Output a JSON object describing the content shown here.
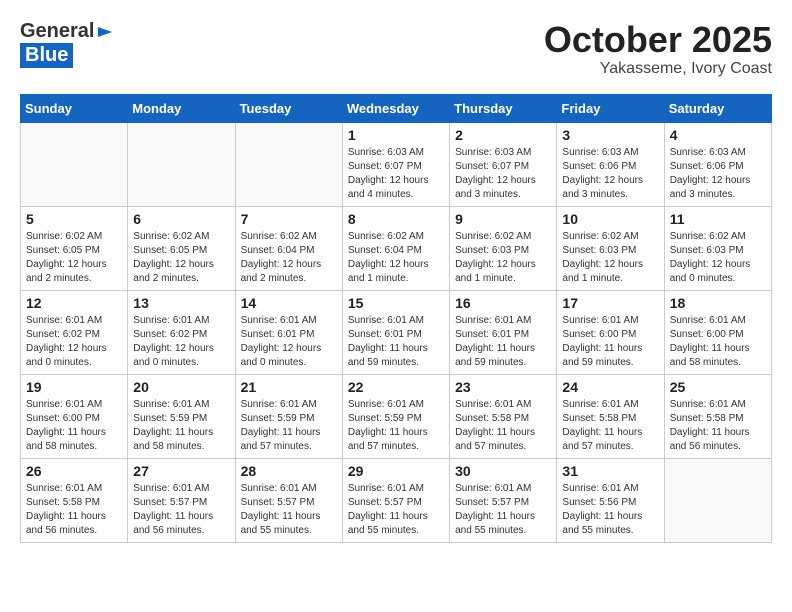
{
  "header": {
    "logo_general": "General",
    "logo_blue": "Blue",
    "title": "October 2025",
    "subtitle": "Yakasseme, Ivory Coast"
  },
  "weekdays": [
    "Sunday",
    "Monday",
    "Tuesday",
    "Wednesday",
    "Thursday",
    "Friday",
    "Saturday"
  ],
  "weeks": [
    [
      {
        "day": "",
        "info": ""
      },
      {
        "day": "",
        "info": ""
      },
      {
        "day": "",
        "info": ""
      },
      {
        "day": "1",
        "info": "Sunrise: 6:03 AM\nSunset: 6:07 PM\nDaylight: 12 hours\nand 4 minutes."
      },
      {
        "day": "2",
        "info": "Sunrise: 6:03 AM\nSunset: 6:07 PM\nDaylight: 12 hours\nand 3 minutes."
      },
      {
        "day": "3",
        "info": "Sunrise: 6:03 AM\nSunset: 6:06 PM\nDaylight: 12 hours\nand 3 minutes."
      },
      {
        "day": "4",
        "info": "Sunrise: 6:03 AM\nSunset: 6:06 PM\nDaylight: 12 hours\nand 3 minutes."
      }
    ],
    [
      {
        "day": "5",
        "info": "Sunrise: 6:02 AM\nSunset: 6:05 PM\nDaylight: 12 hours\nand 2 minutes."
      },
      {
        "day": "6",
        "info": "Sunrise: 6:02 AM\nSunset: 6:05 PM\nDaylight: 12 hours\nand 2 minutes."
      },
      {
        "day": "7",
        "info": "Sunrise: 6:02 AM\nSunset: 6:04 PM\nDaylight: 12 hours\nand 2 minutes."
      },
      {
        "day": "8",
        "info": "Sunrise: 6:02 AM\nSunset: 6:04 PM\nDaylight: 12 hours\nand 1 minute."
      },
      {
        "day": "9",
        "info": "Sunrise: 6:02 AM\nSunset: 6:03 PM\nDaylight: 12 hours\nand 1 minute."
      },
      {
        "day": "10",
        "info": "Sunrise: 6:02 AM\nSunset: 6:03 PM\nDaylight: 12 hours\nand 1 minute."
      },
      {
        "day": "11",
        "info": "Sunrise: 6:02 AM\nSunset: 6:03 PM\nDaylight: 12 hours\nand 0 minutes."
      }
    ],
    [
      {
        "day": "12",
        "info": "Sunrise: 6:01 AM\nSunset: 6:02 PM\nDaylight: 12 hours\nand 0 minutes."
      },
      {
        "day": "13",
        "info": "Sunrise: 6:01 AM\nSunset: 6:02 PM\nDaylight: 12 hours\nand 0 minutes."
      },
      {
        "day": "14",
        "info": "Sunrise: 6:01 AM\nSunset: 6:01 PM\nDaylight: 12 hours\nand 0 minutes."
      },
      {
        "day": "15",
        "info": "Sunrise: 6:01 AM\nSunset: 6:01 PM\nDaylight: 11 hours\nand 59 minutes."
      },
      {
        "day": "16",
        "info": "Sunrise: 6:01 AM\nSunset: 6:01 PM\nDaylight: 11 hours\nand 59 minutes."
      },
      {
        "day": "17",
        "info": "Sunrise: 6:01 AM\nSunset: 6:00 PM\nDaylight: 11 hours\nand 59 minutes."
      },
      {
        "day": "18",
        "info": "Sunrise: 6:01 AM\nSunset: 6:00 PM\nDaylight: 11 hours\nand 58 minutes."
      }
    ],
    [
      {
        "day": "19",
        "info": "Sunrise: 6:01 AM\nSunset: 6:00 PM\nDaylight: 11 hours\nand 58 minutes."
      },
      {
        "day": "20",
        "info": "Sunrise: 6:01 AM\nSunset: 5:59 PM\nDaylight: 11 hours\nand 58 minutes."
      },
      {
        "day": "21",
        "info": "Sunrise: 6:01 AM\nSunset: 5:59 PM\nDaylight: 11 hours\nand 57 minutes."
      },
      {
        "day": "22",
        "info": "Sunrise: 6:01 AM\nSunset: 5:59 PM\nDaylight: 11 hours\nand 57 minutes."
      },
      {
        "day": "23",
        "info": "Sunrise: 6:01 AM\nSunset: 5:58 PM\nDaylight: 11 hours\nand 57 minutes."
      },
      {
        "day": "24",
        "info": "Sunrise: 6:01 AM\nSunset: 5:58 PM\nDaylight: 11 hours\nand 57 minutes."
      },
      {
        "day": "25",
        "info": "Sunrise: 6:01 AM\nSunset: 5:58 PM\nDaylight: 11 hours\nand 56 minutes."
      }
    ],
    [
      {
        "day": "26",
        "info": "Sunrise: 6:01 AM\nSunset: 5:58 PM\nDaylight: 11 hours\nand 56 minutes."
      },
      {
        "day": "27",
        "info": "Sunrise: 6:01 AM\nSunset: 5:57 PM\nDaylight: 11 hours\nand 56 minutes."
      },
      {
        "day": "28",
        "info": "Sunrise: 6:01 AM\nSunset: 5:57 PM\nDaylight: 11 hours\nand 55 minutes."
      },
      {
        "day": "29",
        "info": "Sunrise: 6:01 AM\nSunset: 5:57 PM\nDaylight: 11 hours\nand 55 minutes."
      },
      {
        "day": "30",
        "info": "Sunrise: 6:01 AM\nSunset: 5:57 PM\nDaylight: 11 hours\nand 55 minutes."
      },
      {
        "day": "31",
        "info": "Sunrise: 6:01 AM\nSunset: 5:56 PM\nDaylight: 11 hours\nand 55 minutes."
      },
      {
        "day": "",
        "info": ""
      }
    ]
  ]
}
